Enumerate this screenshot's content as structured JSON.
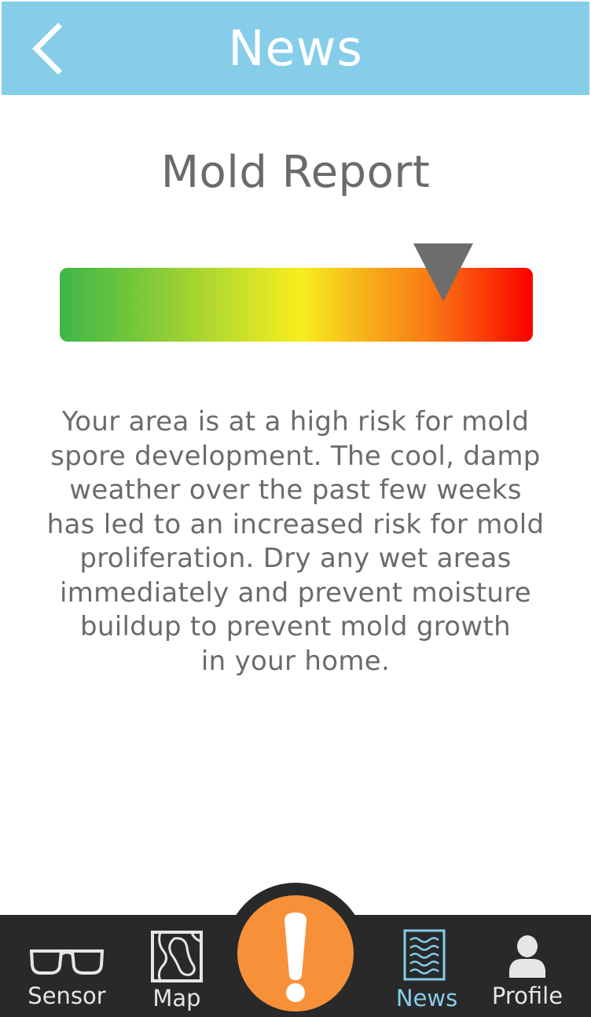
{
  "header": {
    "title": "News"
  },
  "report": {
    "title": "Mold Report",
    "risk_level": 0.81,
    "description_lines": [
      "Your area is at a high risk for mold",
      "spore development. The cool, damp",
      "weather over the past few weeks",
      "has led to an increased risk for mold",
      "proliferation. Dry any wet areas",
      "immediately and prevent moisture",
      "buildup to prevent mold growth",
      "in your home."
    ]
  },
  "tabs": [
    {
      "label": "Sensor",
      "icon": "glasses-icon",
      "active": false
    },
    {
      "label": "Map",
      "icon": "map-icon",
      "active": false
    },
    {
      "label": "News",
      "icon": "news-icon",
      "active": true
    },
    {
      "label": "Profile",
      "icon": "user-icon",
      "active": false
    }
  ],
  "alert": {
    "icon": "exclamation-icon"
  },
  "colors": {
    "header_bg": "#86cde9",
    "text_gray": "#6b6b6b",
    "tab_bar_bg": "#292929",
    "accent_orange": "#f6913a",
    "active_tab": "#86cde9"
  }
}
